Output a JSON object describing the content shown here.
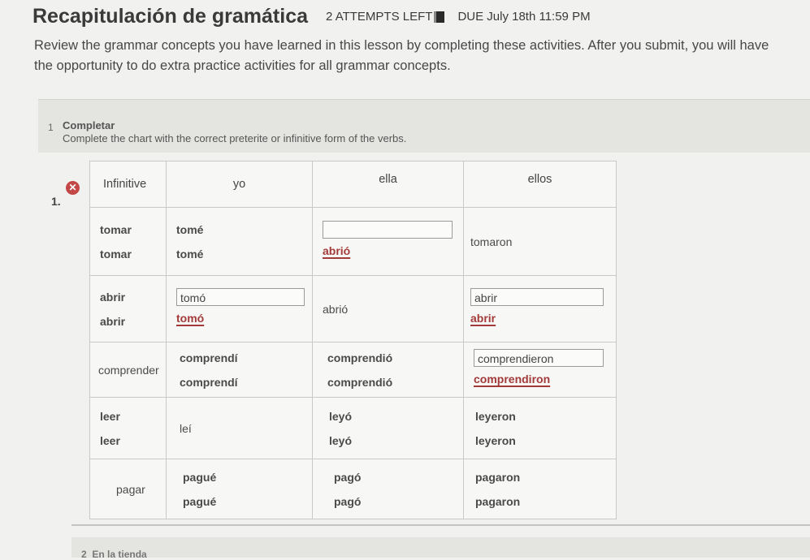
{
  "header": {
    "title": "Recapitulación de gramática",
    "attempts": "2 ATTEMPTS LEFT",
    "due": "DUE July 18th 11:59 PM"
  },
  "intro": {
    "line1": "Review the grammar concepts you have learned in this lesson by completing these activities. After you submit, you will have",
    "line2": "the opportunity to do extra practice activities for all grammar concepts."
  },
  "activity": {
    "number": "1",
    "title": "Completar",
    "instruction": "Complete the chart with the correct preterite or infinitive form of the verbs."
  },
  "item": {
    "number": "1.",
    "status_icon": "error-x-icon"
  },
  "table": {
    "headers": [
      "Infinitive",
      "yo",
      "ella",
      "ellos"
    ],
    "rows": [
      {
        "infinitive": [
          "tomar",
          "tomar"
        ],
        "yo": [
          "tomé",
          "tomé"
        ],
        "ella_input": "",
        "ella_correct": "abrió",
        "ellos": "tomaron"
      },
      {
        "infinitive": [
          "abrir",
          "abrir"
        ],
        "yo_input": "tomó",
        "yo_correct": "tomó",
        "ella": "abrió",
        "ellos_input": "abrir",
        "ellos_correct": "abrir"
      },
      {
        "infinitive": "comprender",
        "yo": [
          "comprendí",
          "comprendí"
        ],
        "ella": [
          "comprendió",
          "comprendió"
        ],
        "ellos_input": "comprendieron",
        "ellos_correct": "comprendiron"
      },
      {
        "infinitive": [
          "leer",
          "leer"
        ],
        "yo": "leí",
        "ella": [
          "leyó",
          "leyó"
        ],
        "ellos": [
          "leyeron",
          "leyeron"
        ]
      },
      {
        "infinitive": "pagar",
        "yo": [
          "pagué",
          "pagué"
        ],
        "ella": [
          "pagó",
          "pagó"
        ],
        "ellos": [
          "pagaron",
          "pagaron"
        ]
      }
    ]
  },
  "next_activity": {
    "number": "2",
    "title": "En la tienda"
  },
  "colors": {
    "error": "#c44747",
    "correction": "#a33a3a"
  }
}
